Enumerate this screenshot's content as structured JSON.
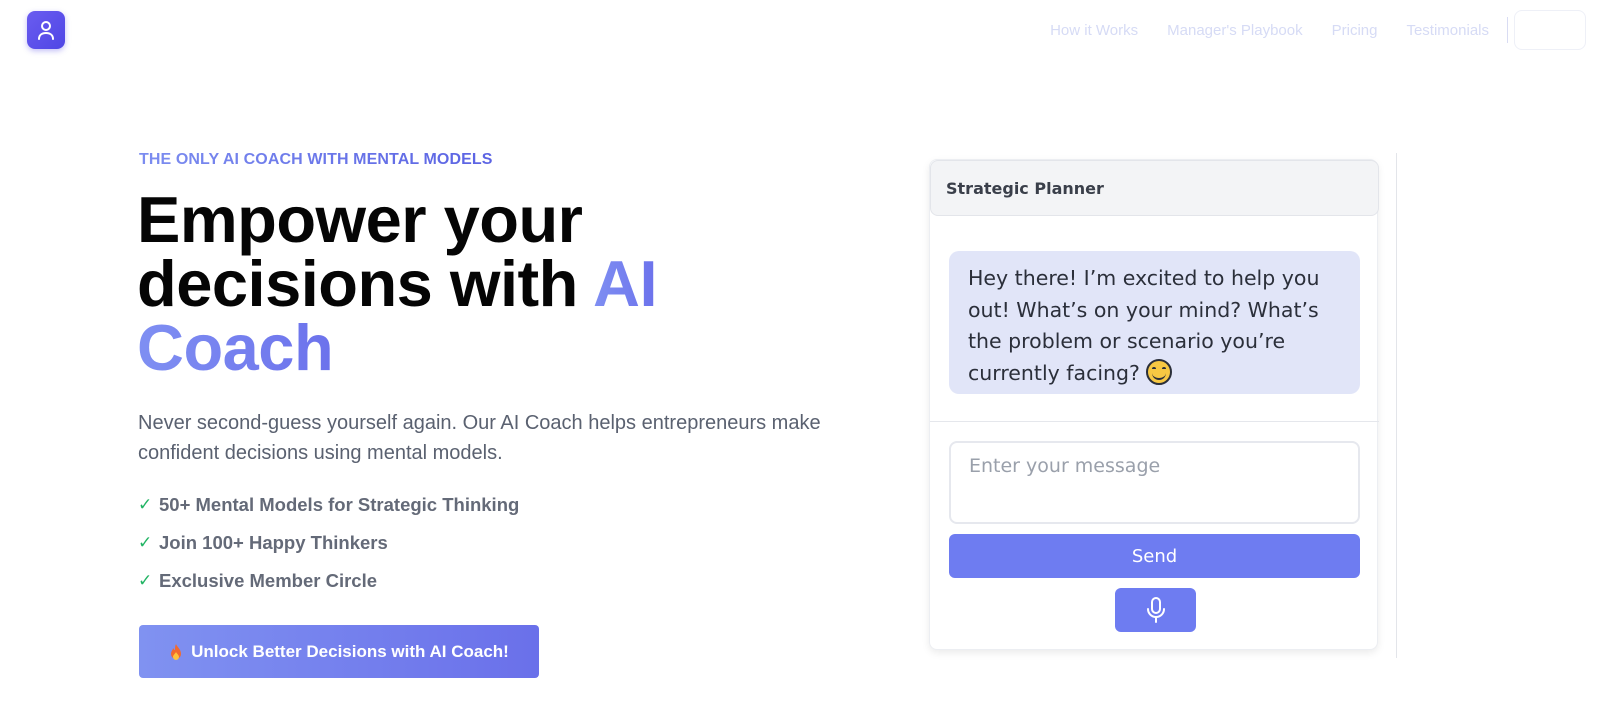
{
  "header": {
    "logo_icon": "user-icon",
    "nav": [
      {
        "label": "How it Works"
      },
      {
        "label": "Manager's Playbook"
      },
      {
        "label": "Pricing"
      },
      {
        "label": "Testimonials"
      }
    ]
  },
  "hero": {
    "eyebrow": "THE ONLY AI COACH WITH MENTAL MODELS",
    "headline_line1": "Empower your",
    "headline_line2": "decisions with ",
    "headline_accent_1": "AI",
    "headline_accent_2": "Coach",
    "subtitle": "Never second-guess yourself again. Our AI Coach helps entrepreneurs make confident decisions using mental models.",
    "features": [
      {
        "check": "✓",
        "text": "50+ Mental Models for Strategic Thinking"
      },
      {
        "check": "✓",
        "text": "Join 100+ Happy Thinkers"
      },
      {
        "check": "✓",
        "text": "Exclusive Member Circle"
      }
    ],
    "cta_icon": "fire-icon",
    "cta_label": "Unlock Better Decisions with AI Coach!"
  },
  "chat": {
    "title": "Strategic Planner",
    "assistant_message": "Hey there! I’m excited to help you out! What’s on your mind? What’s the problem or scenario you’re currently facing?",
    "input_placeholder": "Enter your message",
    "send_label": "Send",
    "mic_icon": "microphone-icon"
  },
  "colors": {
    "accent": "#6e7cf1",
    "logo": "#5b52ec",
    "check": "#22b464",
    "bubble_bg": "#e1e5f8"
  }
}
